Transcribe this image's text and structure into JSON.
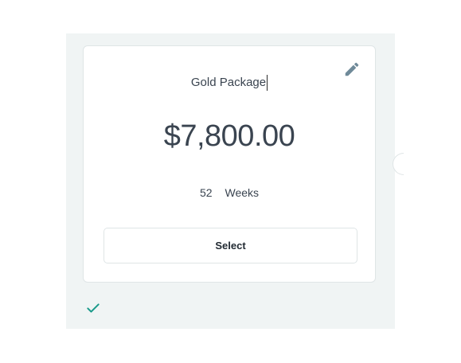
{
  "package": {
    "title": "Gold Package",
    "price": "$7,800.00",
    "term_value": "52",
    "term_unit": "Weeks",
    "select_label": "Select"
  },
  "icons": {
    "edit": "pencil-icon",
    "selected": "check-icon"
  },
  "colors": {
    "panel_bg": "#f0f4f4",
    "text": "#3a4450",
    "accent_check": "#1a9a8a",
    "edit_icon": "#6f8a99"
  }
}
